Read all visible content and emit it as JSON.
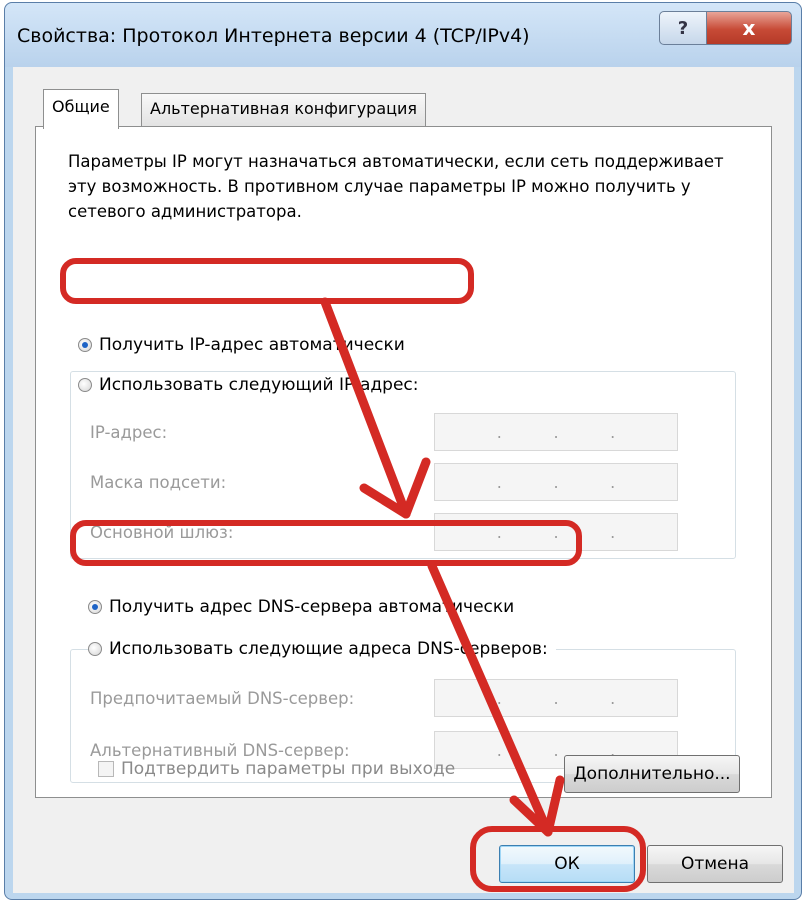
{
  "window": {
    "title": "Свойства: Протокол Интернета версии 4 (TCP/IPv4)",
    "help_glyph": "?",
    "close_glyph": "x"
  },
  "tabs": [
    {
      "label": "Общие",
      "active": true
    },
    {
      "label": "Альтернативная конфигурация",
      "active": false
    }
  ],
  "description": "Параметры IP могут назначаться автоматически, если сеть поддерживает эту возможность. В противном случае параметры IP можно получить у сетевого администратора.",
  "ip_section": {
    "auto_label": "Получить IP-адрес автоматически",
    "manual_label": "Использовать следующий IP-адрес:",
    "selected": "auto",
    "fields": [
      {
        "label": "IP-адрес:",
        "value": ". . ."
      },
      {
        "label": "Маска подсети:",
        "value": ". . ."
      },
      {
        "label": "Основной шлюз:",
        "value": ". . ."
      }
    ]
  },
  "dns_section": {
    "auto_label": "Получить адрес DNS-сервера автоматически",
    "manual_label": "Использовать следующие адреса DNS-серверов:",
    "selected": "auto",
    "fields": [
      {
        "label": "Предпочитаемый DNS-сервер:",
        "value": ". . ."
      },
      {
        "label": "Альтернативный DNS-сервер:",
        "value": ". . ."
      }
    ]
  },
  "validate_on_exit": {
    "label": "Подтвердить параметры при выходе",
    "checked": false
  },
  "buttons": {
    "advanced": "Дополнительно...",
    "ok": "ОК",
    "cancel": "Отмена"
  },
  "colors": {
    "annotation": "#d42a24",
    "radio_dot": "#1d63c6",
    "frame": "#bcd6ee"
  }
}
